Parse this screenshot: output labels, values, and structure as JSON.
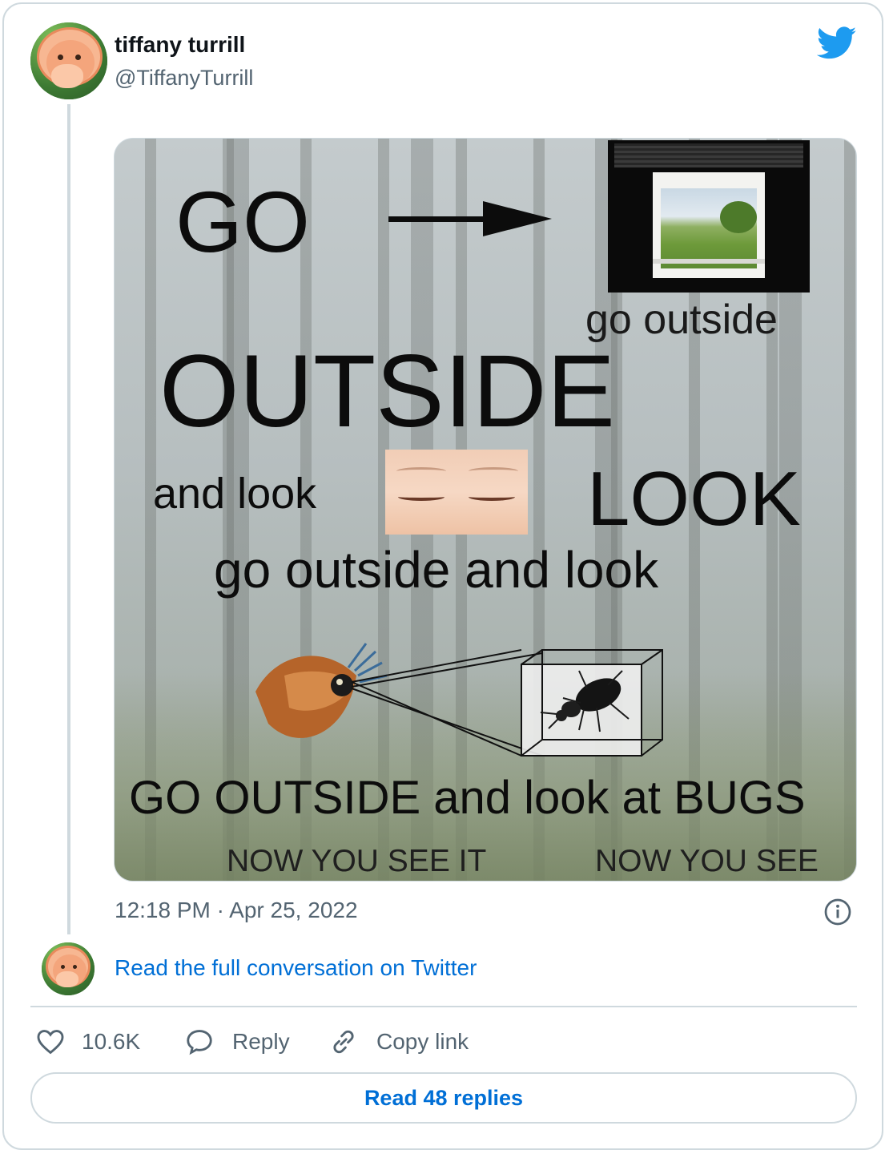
{
  "tweet": {
    "author_name": "tiffany turrill",
    "author_handle": "@TiffanyTurrill",
    "timestamp": "12:18 PM · Apr 25, 2022",
    "read_conversation_link": "Read the full conversation on Twitter",
    "image_text": {
      "go": "GO",
      "go_outside_small": "go outside",
      "outside": "OUTSIDE",
      "and_look": "and look",
      "look": "LOOK",
      "go_outside_and_look": "go outside and look",
      "bugs_line": "GO OUTSIDE and look at BUGS",
      "now_you_see_it": "NOW YOU SEE IT",
      "now_you_see": "NOW YOU SEE"
    }
  },
  "actions": {
    "like_count": "10.6K",
    "reply_label": "Reply",
    "copy_link_label": "Copy link",
    "read_replies_label": "Read 48 replies"
  },
  "colors": {
    "brand_blue": "#1d9bf0",
    "link_blue": "#006fd6",
    "border": "#cfd9de",
    "secondary_text": "#536471"
  },
  "icons": {
    "brand": "twitter-bird-icon",
    "info": "info-icon",
    "like": "heart-icon",
    "reply": "speech-bubble-icon",
    "copy_link": "link-icon"
  }
}
